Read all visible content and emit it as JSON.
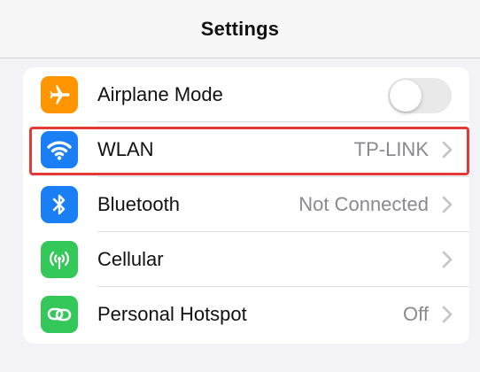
{
  "navbar": {
    "title": "Settings"
  },
  "settings": {
    "airplane": {
      "label": "Airplane Mode",
      "toggle_on": false,
      "icon": "airplane-icon",
      "color": "#ff9500"
    },
    "wlan": {
      "label": "WLAN",
      "value": "TP-LINK",
      "icon": "wifi-icon",
      "color": "#1a7ff5"
    },
    "bluetooth": {
      "label": "Bluetooth",
      "value": "Not Connected",
      "icon": "bluetooth-icon",
      "color": "#1a7ff5"
    },
    "cellular": {
      "label": "Cellular",
      "value": "",
      "icon": "antenna-icon",
      "color": "#34c759"
    },
    "hotspot": {
      "label": "Personal Hotspot",
      "value": "Off",
      "icon": "hotspot-link-icon",
      "color": "#34c759"
    }
  },
  "colors": {
    "highlight": "#e53935",
    "background": "#f2f2f7",
    "secondary_text": "#8a8a8e"
  }
}
